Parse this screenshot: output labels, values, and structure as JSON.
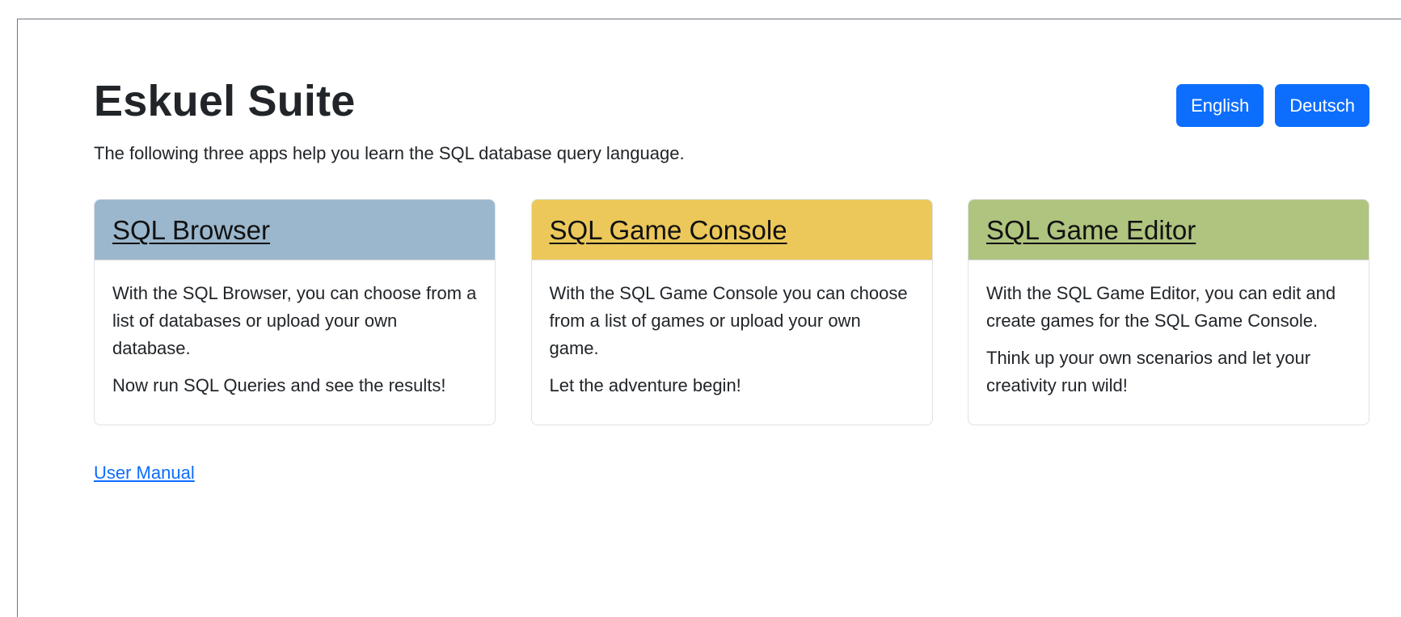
{
  "header": {
    "title": "Eskuel Suite",
    "subtitle": "The following three apps help you learn the SQL database query language.",
    "languages": [
      "English",
      "Deutsch"
    ]
  },
  "cards": [
    {
      "title": "SQL Browser",
      "header_color": "#9bb7cd",
      "paragraphs": [
        "With the SQL Browser, you can choose from a list of databases or upload your own database.",
        "Now run SQL Queries and see the results!"
      ]
    },
    {
      "title": "SQL Game Console",
      "header_color": "#ecc85a",
      "paragraphs": [
        "With the SQL Game Console you can choose from a list of games or upload your own game.",
        "Let the adventure begin!"
      ]
    },
    {
      "title": "SQL Game Editor",
      "header_color": "#afc47f",
      "paragraphs": [
        "With the SQL Game Editor, you can edit and create games for the SQL Game Console.",
        "Think up your own scenarios and let your creativity run wild!"
      ]
    }
  ],
  "footer": {
    "manual_link": "User Manual"
  },
  "colors": {
    "primary": "#0d6efd",
    "text": "#212529",
    "frame_border": "#6c757d"
  }
}
